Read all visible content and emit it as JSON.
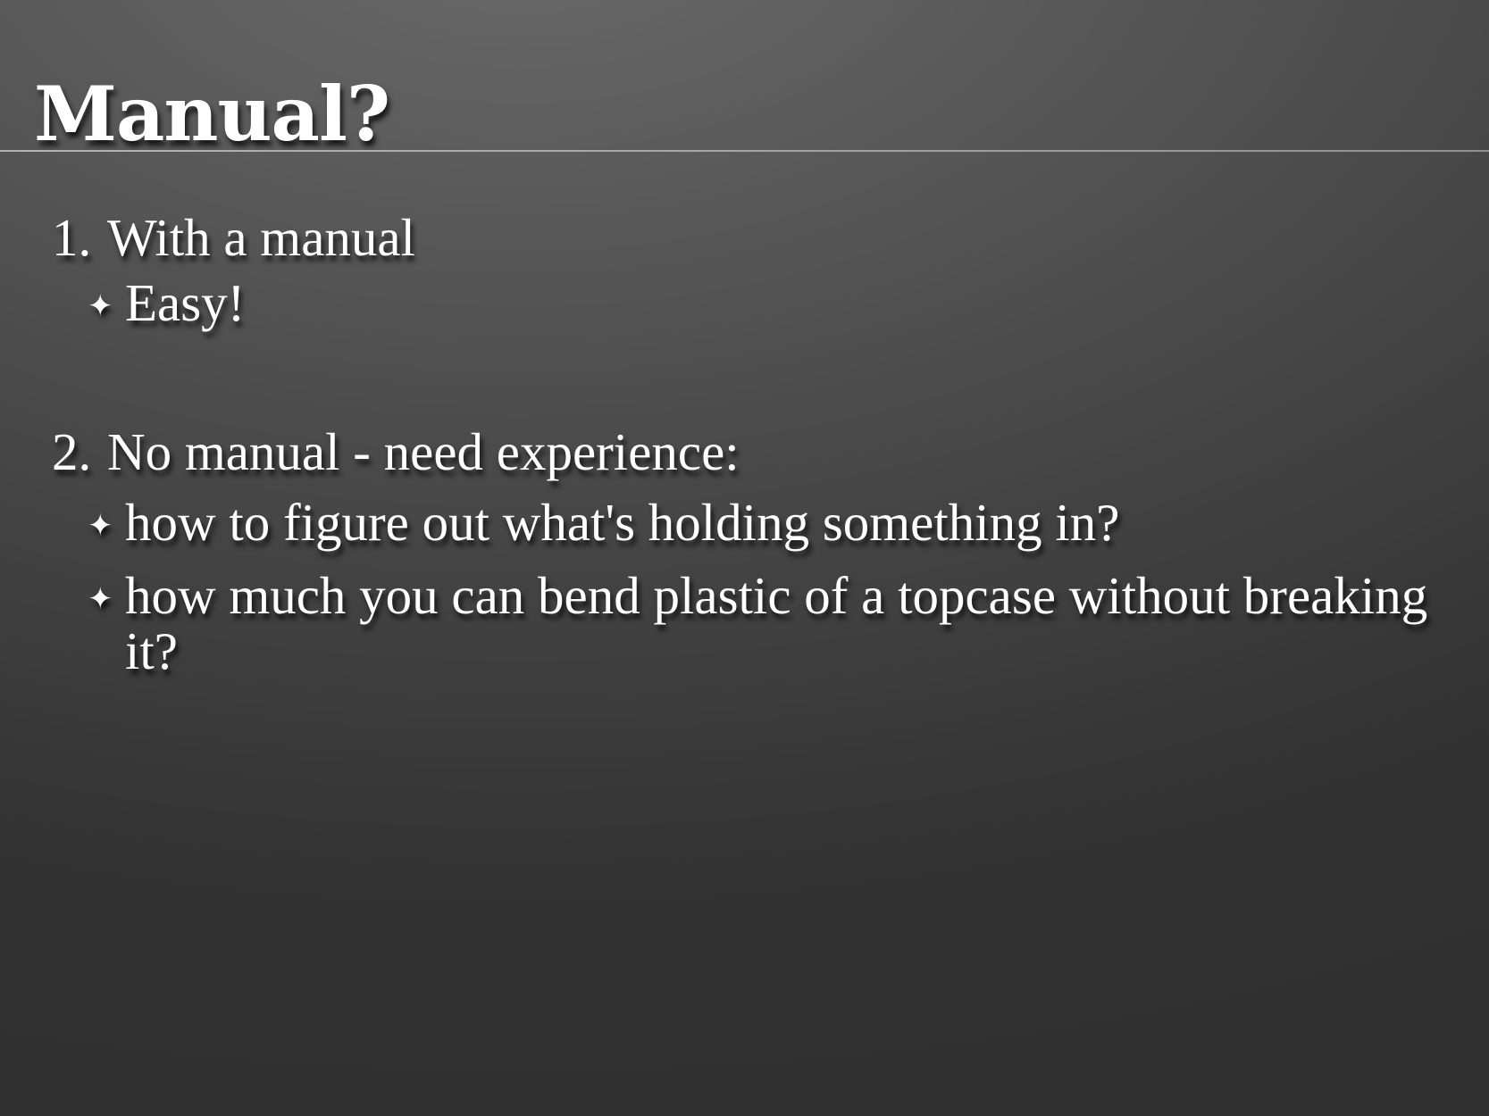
{
  "slide": {
    "title": "Manual?",
    "items": [
      {
        "number": "1.",
        "text": "With a manual",
        "bullets": [
          "Easy!"
        ]
      },
      {
        "number": "2.",
        "text": "No manual - need experience:",
        "bullets": [
          "how to figure out what's holding something in?",
          "how much you can bend plastic of a topcase without breaking it?"
        ]
      }
    ],
    "bullet_icon": "four-pointed-star-icon"
  },
  "colors": {
    "background_top": "#6c6c6c",
    "background_bottom": "#303030",
    "text": "#ffffff"
  }
}
